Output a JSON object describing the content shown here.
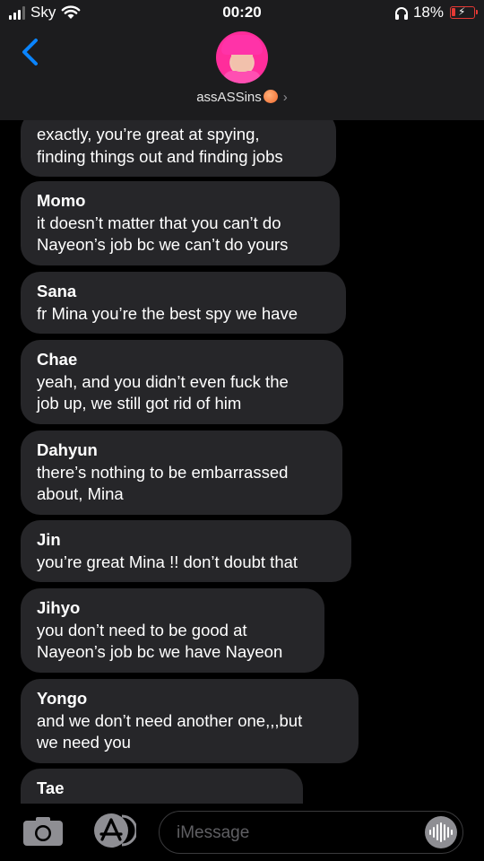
{
  "status_bar": {
    "carrier": "Sky",
    "time": "00:20",
    "battery_percent": "18%",
    "battery_level": 0.18,
    "colors": {
      "battery": "#e53935"
    },
    "icons": [
      "signal-icon",
      "wifi-icon",
      "headphones-icon",
      "battery-icon"
    ]
  },
  "header": {
    "contact_name": "assASSins",
    "icons": [
      "back-chevron-icon",
      "peach-emoji-icon",
      "chevron-right-icon"
    ]
  },
  "messages": [
    {
      "sender": "",
      "text": "exactly, you’re great at spying,\nfinding things out and finding jobs"
    },
    {
      "sender": "Momo",
      "text": "it doesn’t matter that you can’t do\nNayeon’s job bc we can’t do yours"
    },
    {
      "sender": "Sana",
      "text": "fr Mina you’re the best spy we have"
    },
    {
      "sender": "Chae",
      "text": "yeah, and you didn’t even fuck the\njob up, we still got rid of him"
    },
    {
      "sender": "Dahyun",
      "text": "there’s nothing to be embarrassed\nabout, Mina"
    },
    {
      "sender": "Jin",
      "text": "you’re great Mina !! don’t doubt that"
    },
    {
      "sender": "Jihyo",
      "text": "you don’t need to be good at\nNayeon’s job bc we have Nayeon"
    },
    {
      "sender": "Yongo",
      "text": "and we don’t need another one,,,but\nwe need you"
    },
    {
      "sender": "Tae",
      "text": ""
    }
  ],
  "composer": {
    "placeholder": "iMessage",
    "icons": [
      "camera-icon",
      "app-store-icon",
      "audio-waveform-icon"
    ]
  }
}
